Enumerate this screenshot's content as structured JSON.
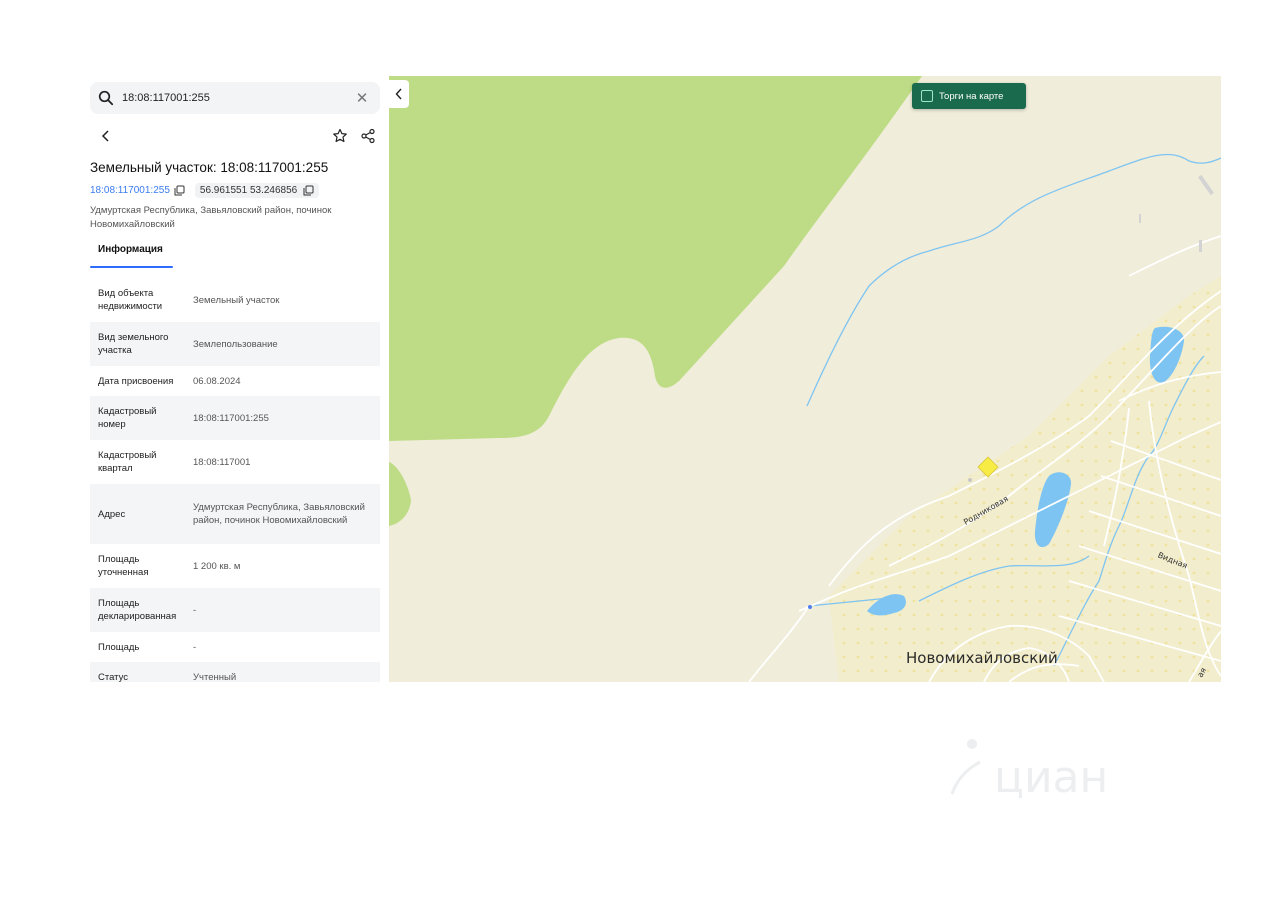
{
  "search": {
    "value": "18:08:117001:255",
    "icon": "search-icon",
    "clear_icon": "close-icon"
  },
  "toolbar": {
    "back_icon": "chevron-left-icon",
    "favorite_icon": "star-icon",
    "share_icon": "share-icon"
  },
  "object": {
    "title": "Земельный участок: 18:08:117001:255",
    "cadastral_link": "18:08:117001:255",
    "coordinates": "56.961551 53.246856",
    "address": "Удмуртская Республика, Завьяловский район, починок Новомихайловский"
  },
  "tabs": [
    {
      "label": "Информация",
      "active": true
    }
  ],
  "info_rows": [
    {
      "key": "Вид объекта недвижимости",
      "value": "Земельный участок"
    },
    {
      "key": "Вид земельного участка",
      "value": "Землепользование"
    },
    {
      "key": "Дата присвоения",
      "value": "06.08.2024"
    },
    {
      "key": "Кадастровый номер",
      "value": "18:08:117001:255"
    },
    {
      "key": "Кадастровый квартал",
      "value": "18:08:117001"
    },
    {
      "key": "Адрес",
      "value": "Удмуртская Республика, Завьяловский район, починок Новомихайловский"
    },
    {
      "key": "Площадь уточненная",
      "value": "1 200 кв. м"
    },
    {
      "key": "Площадь декларированная",
      "value": "-"
    },
    {
      "key": "Площадь",
      "value": "-"
    },
    {
      "key": "Статус",
      "value": "Учтенный"
    }
  ],
  "map": {
    "collapse_icon": "chevron-left-icon",
    "torgi_toggle": {
      "label": "Торги на карте",
      "checked": false
    },
    "labels": {
      "settlement": "Новомихайловский",
      "street1": "Родниковая",
      "street2": "Видная",
      "street3": "ая"
    },
    "colors": {
      "forest": "#bddc85",
      "water": "#7ec4f2",
      "land": "#f0edda",
      "settlement": "#f1ecc8",
      "plot": "#f7ec46"
    }
  },
  "watermark": {
    "text": "циан"
  }
}
